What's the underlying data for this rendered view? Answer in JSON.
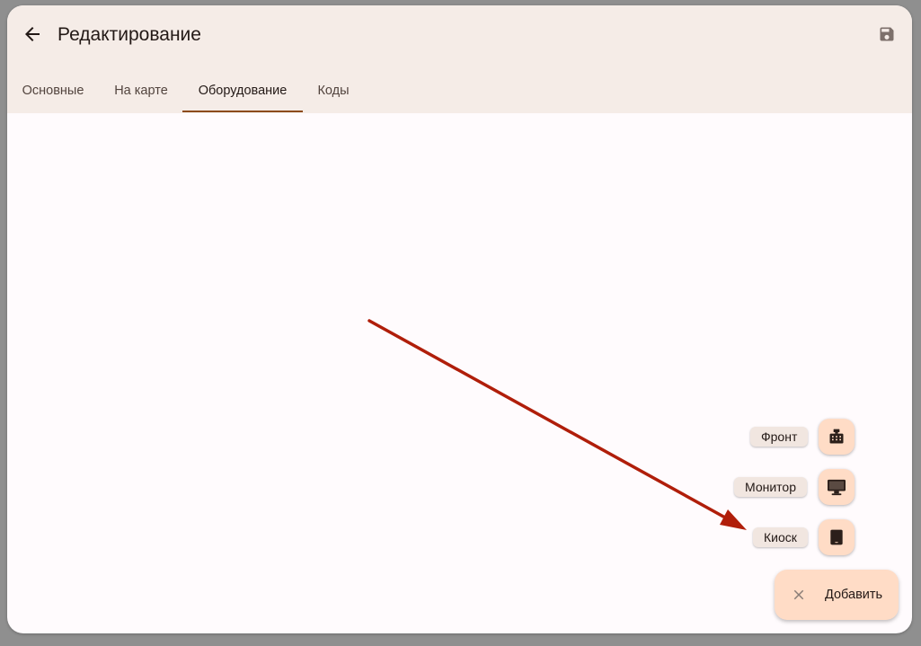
{
  "header": {
    "title": "Редактирование",
    "back_icon": "arrow-back-icon",
    "save_icon": "save-icon"
  },
  "tabs": [
    {
      "label": "Основные",
      "active": false
    },
    {
      "label": "На карте",
      "active": false
    },
    {
      "label": "Оборудование",
      "active": true
    },
    {
      "label": "Коды",
      "active": false
    }
  ],
  "speed_dial": {
    "items": [
      {
        "label": "Фронт",
        "icon": "cash-register-icon"
      },
      {
        "label": "Монитор",
        "icon": "monitor-icon"
      },
      {
        "label": "Киоск",
        "icon": "tablet-icon"
      }
    ],
    "main_button": {
      "label": "Добавить",
      "icon": "close-icon"
    }
  },
  "colors": {
    "header_bg": "#f5ece7",
    "accent": "#8c4a1c",
    "fab_bg": "#ffdcc6",
    "annotation_arrow": "#b01e0a"
  }
}
